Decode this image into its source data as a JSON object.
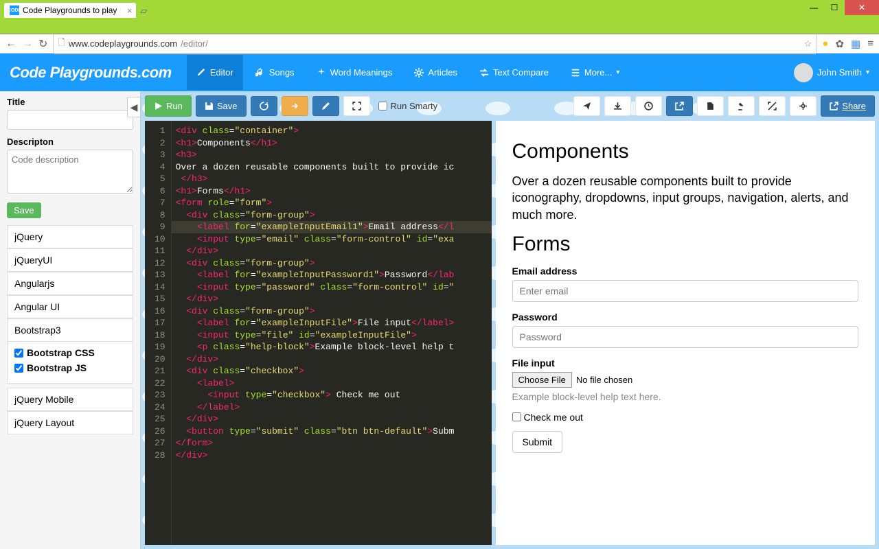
{
  "browser": {
    "tabTitle": "Code Playgrounds to play",
    "tabIcon": "CODE",
    "urlHost": "www.codeplaygrounds.com",
    "urlPath": "/editor/"
  },
  "header": {
    "brand": "Code Playgrounds.com",
    "nav": [
      {
        "icon": "editor",
        "label": "Editor"
      },
      {
        "icon": "music",
        "label": "Songs"
      },
      {
        "icon": "sparkle",
        "label": "Word Meanings"
      },
      {
        "icon": "gear",
        "label": "Articles"
      },
      {
        "icon": "compare",
        "label": "Text Compare"
      },
      {
        "icon": "menu",
        "label": "More..."
      }
    ],
    "user": "John Smith"
  },
  "sidebar": {
    "titleLabel": "Title",
    "descLabel": "Descripton",
    "descPlaceholder": "Code description",
    "saveLabel": "Save",
    "libs": [
      "jQuery",
      "jQueryUI",
      "Angularjs",
      "Angular UI",
      "Bootstrap3"
    ],
    "bootstrapSubs": [
      "Bootstrap CSS",
      "Bootstrap JS"
    ],
    "libs2": [
      "jQuery Mobile",
      "jQuery Layout"
    ]
  },
  "toolbar": {
    "run": "Run",
    "save": "Save",
    "runSmarty": "Run Smarty",
    "share": "Share"
  },
  "code": [
    {
      "n": 1,
      "html": "<span class='tag'>&lt;div</span> <span class='attr'>class</span>=<span class='str'>\"container\"</span><span class='tag'>&gt;</span>"
    },
    {
      "n": 2,
      "html": "<span class='tag'>&lt;h1&gt;</span><span class='txt'>Components</span><span class='tag'>&lt;/h1&gt;</span>"
    },
    {
      "n": 3,
      "html": "<span class='tag'>&lt;h3&gt;</span>"
    },
    {
      "n": 4,
      "html": "<span class='txt'>Over a dozen reusable components built to provide ic</span>"
    },
    {
      "n": 5,
      "html": " <span class='tag'>&lt;/h3&gt;</span>"
    },
    {
      "n": 6,
      "html": "<span class='tag'>&lt;h1&gt;</span><span class='txt'>Forms</span><span class='tag'>&lt;/h1&gt;</span>"
    },
    {
      "n": 7,
      "html": "<span class='tag'>&lt;form</span> <span class='attr'>role</span>=<span class='str'>\"form\"</span><span class='tag'>&gt;</span>"
    },
    {
      "n": 8,
      "html": "  <span class='tag'>&lt;div</span> <span class='attr'>class</span>=<span class='str'>\"form-group\"</span><span class='tag'>&gt;</span>"
    },
    {
      "n": 9,
      "html": "    <span class='tag'>&lt;label</span> <span class='attr'>for</span>=<span class='str'>\"exampleInputEmail1\"</span><span class='tag'>&gt;</span><span class='txt'>Email address</span><span class='tag'>&lt;/l</span>",
      "hl": true
    },
    {
      "n": 10,
      "html": "    <span class='tag'>&lt;input</span> <span class='attr'>type</span>=<span class='str'>\"email\"</span> <span class='attr'>class</span>=<span class='str'>\"form-control\"</span> <span class='attr'>id</span>=<span class='str'>\"exa</span>"
    },
    {
      "n": 11,
      "html": "  <span class='tag'>&lt;/div&gt;</span>"
    },
    {
      "n": 12,
      "html": "  <span class='tag'>&lt;div</span> <span class='attr'>class</span>=<span class='str'>\"form-group\"</span><span class='tag'>&gt;</span>"
    },
    {
      "n": 13,
      "html": "    <span class='tag'>&lt;label</span> <span class='attr'>for</span>=<span class='str'>\"exampleInputPassword1\"</span><span class='tag'>&gt;</span><span class='txt'>Password</span><span class='tag'>&lt;/lab</span>"
    },
    {
      "n": 14,
      "html": "    <span class='tag'>&lt;input</span> <span class='attr'>type</span>=<span class='str'>\"password\"</span> <span class='attr'>class</span>=<span class='str'>\"form-control\"</span> <span class='attr'>id</span>=<span class='str'>\"</span>"
    },
    {
      "n": 15,
      "html": "  <span class='tag'>&lt;/div&gt;</span>"
    },
    {
      "n": 16,
      "html": "  <span class='tag'>&lt;div</span> <span class='attr'>class</span>=<span class='str'>\"form-group\"</span><span class='tag'>&gt;</span>"
    },
    {
      "n": 17,
      "html": "    <span class='tag'>&lt;label</span> <span class='attr'>for</span>=<span class='str'>\"exampleInputFile\"</span><span class='tag'>&gt;</span><span class='txt'>File input</span><span class='tag'>&lt;/label&gt;</span>"
    },
    {
      "n": 18,
      "html": "    <span class='tag'>&lt;input</span> <span class='attr'>type</span>=<span class='str'>\"file\"</span> <span class='attr'>id</span>=<span class='str'>\"exampleInputFile\"</span><span class='tag'>&gt;</span>"
    },
    {
      "n": 19,
      "html": "    <span class='tag'>&lt;p</span> <span class='attr'>class</span>=<span class='str'>\"help-block\"</span><span class='tag'>&gt;</span><span class='txt'>Example block-level help t</span>"
    },
    {
      "n": 20,
      "html": "  <span class='tag'>&lt;/div&gt;</span>"
    },
    {
      "n": 21,
      "html": "  <span class='tag'>&lt;div</span> <span class='attr'>class</span>=<span class='str'>\"checkbox\"</span><span class='tag'>&gt;</span>"
    },
    {
      "n": 22,
      "html": "    <span class='tag'>&lt;label&gt;</span>"
    },
    {
      "n": 23,
      "html": "      <span class='tag'>&lt;input</span> <span class='attr'>type</span>=<span class='str'>\"checkbox\"</span><span class='tag'>&gt;</span> <span class='txt'>Check me out</span>"
    },
    {
      "n": 24,
      "html": "    <span class='tag'>&lt;/label&gt;</span>"
    },
    {
      "n": 25,
      "html": "  <span class='tag'>&lt;/div&gt;</span>"
    },
    {
      "n": 26,
      "html": "  <span class='tag'>&lt;button</span> <span class='attr'>type</span>=<span class='str'>\"submit\"</span> <span class='attr'>class</span>=<span class='str'>\"btn btn-default\"</span><span class='tag'>&gt;</span><span class='txt'>Subm</span>"
    },
    {
      "n": 27,
      "html": "<span class='tag'>&lt;/form&gt;</span>"
    },
    {
      "n": 28,
      "html": "<span class='tag'>&lt;/div&gt;</span>"
    }
  ],
  "preview": {
    "h1a": "Components",
    "desc": "Over a dozen reusable components built to provide iconography, dropdowns, input groups, navigation, alerts, and much more.",
    "h1b": "Forms",
    "emailLabel": "Email address",
    "emailPlaceholder": "Enter email",
    "passwordLabel": "Password",
    "passwordPlaceholder": "Password",
    "fileLabel": "File input",
    "chooseFile": "Choose File",
    "noFile": "No file chosen",
    "helpBlock": "Example block-level help text here.",
    "checkLabel": "Check me out",
    "submit": "Submit"
  }
}
